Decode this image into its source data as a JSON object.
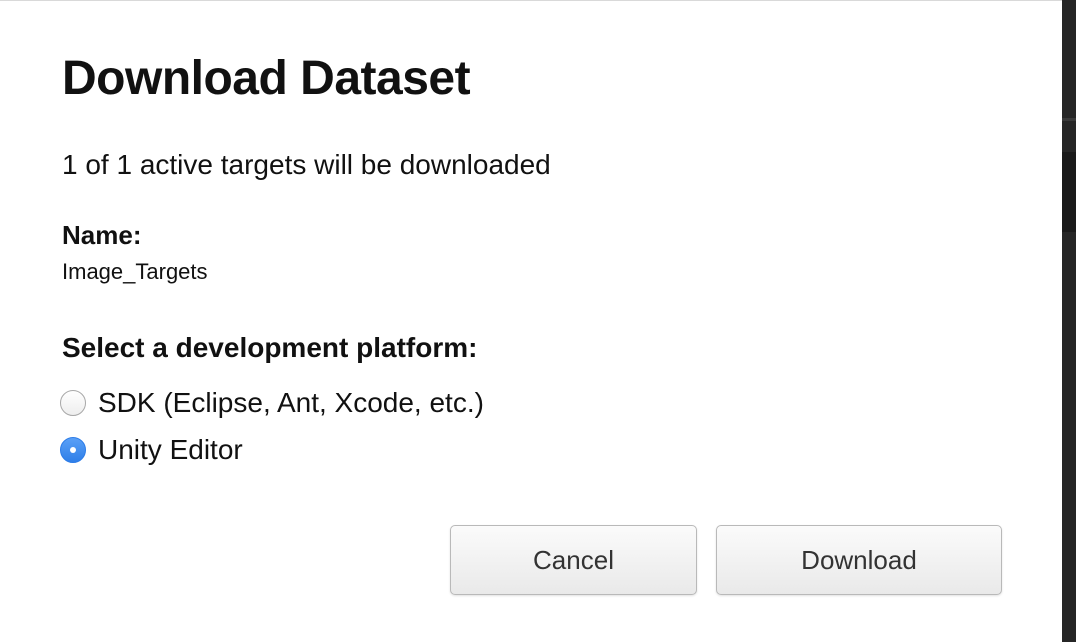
{
  "dialog": {
    "title": "Download Dataset",
    "summary": "1 of 1 active targets will be downloaded",
    "name_label": "Name:",
    "name_value": "Image_Targets",
    "platform_label": "Select a development platform:",
    "platform_options": [
      {
        "label": "SDK (Eclipse, Ant, Xcode, etc.)",
        "selected": false
      },
      {
        "label": "Unity Editor",
        "selected": true
      }
    ],
    "buttons": {
      "cancel_label": "Cancel",
      "download_label": "Download"
    }
  },
  "colors": {
    "accent": "#2f7fe8",
    "dialog_background": "#ffffff",
    "backdrop": "#2a2a2a"
  }
}
